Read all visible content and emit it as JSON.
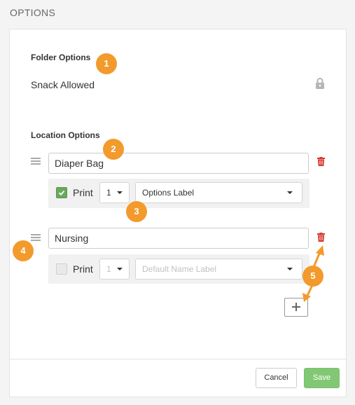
{
  "header": {
    "title": "OPTIONS"
  },
  "folder_options": {
    "heading": "Folder Options",
    "snack_label": "Snack Allowed",
    "lock_icon": "lock-icon"
  },
  "location_options": {
    "heading": "Location Options",
    "items": [
      {
        "name": "Diaper Bag",
        "print_checked": true,
        "print_label": "Print",
        "copies": "1",
        "label_select": "Options Label",
        "disabled": false
      },
      {
        "name": "Nursing",
        "print_checked": false,
        "print_label": "Print",
        "copies": "1",
        "label_select": "Default Name Label",
        "disabled": true
      }
    ]
  },
  "footer": {
    "cancel_label": "Cancel",
    "save_label": "Save"
  },
  "callouts": [
    "1",
    "2",
    "3",
    "4",
    "5"
  ],
  "colors": {
    "accent_orange": "#f39a2c",
    "save_green": "#82c874",
    "checkbox_green": "#6aa85c",
    "trash_red": "#d9352b"
  }
}
